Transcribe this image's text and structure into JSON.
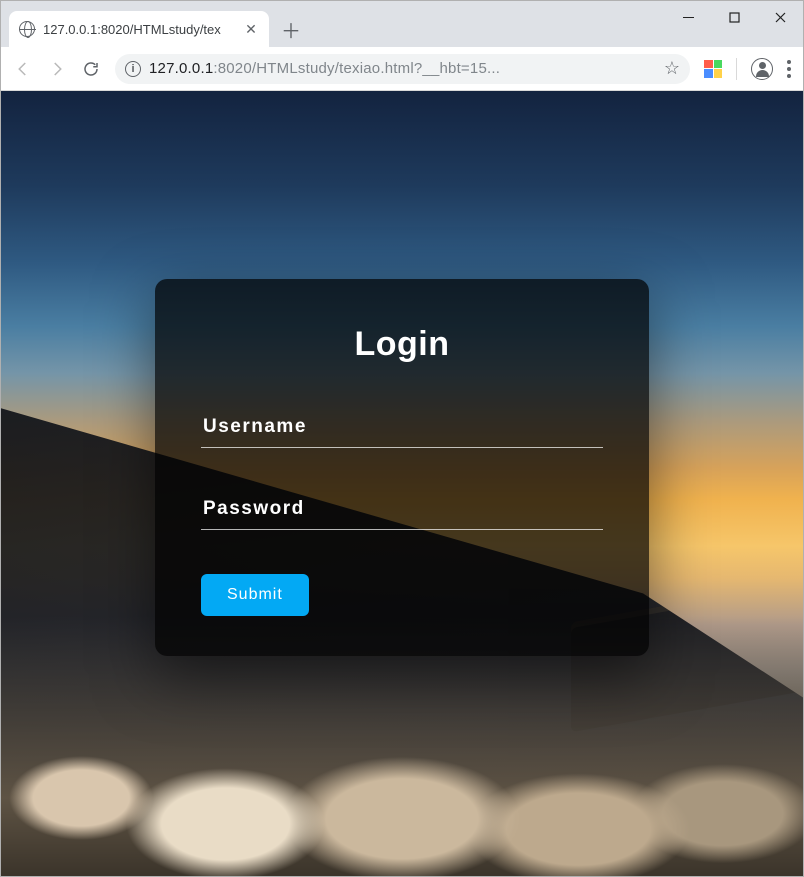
{
  "browser": {
    "tab_title": "127.0.0.1:8020/HTMLstudy/tex",
    "url_host_prefix": "127.0.0.1",
    "url_host_suffix": ":8020",
    "url_path": "/HTMLstudy/texiao.html?__hbt=15...",
    "info_glyph": "i"
  },
  "login": {
    "title": "Login",
    "username_label": "Username",
    "password_label": "Password",
    "submit_label": "Submit"
  }
}
